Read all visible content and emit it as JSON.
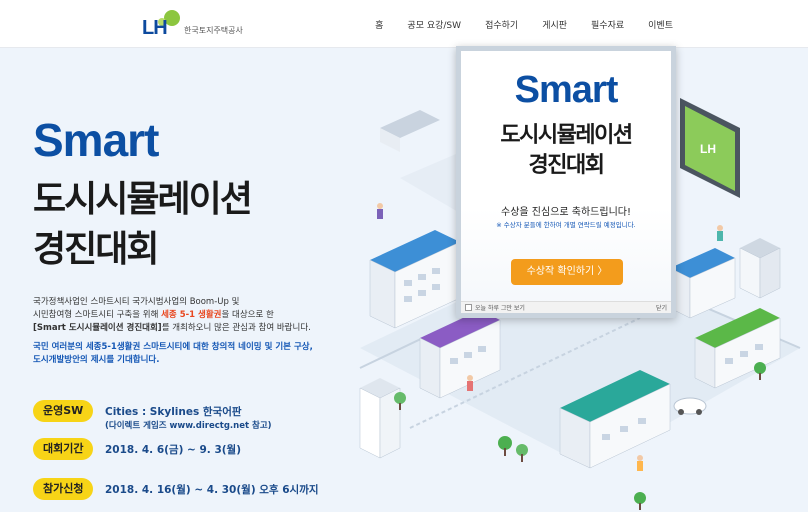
{
  "logo": {
    "mark": "LH",
    "org": "한국토지주택공사"
  },
  "nav": {
    "items": [
      "홈",
      "공모 요강/SW",
      "접수하기",
      "게시판",
      "필수자료",
      "이벤트"
    ]
  },
  "hero": {
    "title_en": "Smart",
    "title_ko_1": "도시시뮬레이션",
    "title_ko_2": "경진대회",
    "desc_line1": "국가정책사업인 스마트시티 국가시범사업의 Boom-Up 및",
    "desc_line2_a": "시민참여형 스마트시티 구축을 위해 ",
    "desc_line2_hl": "세종 5-1 생활권",
    "desc_line2_b": "을 대상으로 한",
    "desc_line3_b": "[Smart 도시시뮬레이션 경진대회]",
    "desc_line3_rest": "를 개최하오니 많은 관심과 참여 바랍니다.",
    "desc2_line1": "국민 여러분의 세종5-1생활권 스마트시티에 대한 창의적 네이밍 및 기본 구상,",
    "desc2_line2": "도시개발방안의 제시를 기대합니다."
  },
  "info": [
    {
      "badge": "운영SW",
      "text": "Cities : Skylines 한국어판"
    },
    {
      "badge": "대회기간",
      "text": "2018. 4. 6(금) ~ 9. 3(월)"
    },
    {
      "badge": "참가신청",
      "text": "2018. 4. 16(월) ~ 4. 30(월) 오후 6시까지"
    }
  ],
  "info_sub": "(다이렉트 게임즈 www.directg.net 참고)",
  "popup": {
    "title_en": "Smart",
    "title_ko_1": "도시시뮬레이션",
    "title_ko_2": "경진대회",
    "message": "수상을 진심으로 축하드립니다!",
    "note": "※ 수상자 분들에 한하여 개별 연락드릴 예정입니다.",
    "button": "수상작 확인하기  〉",
    "today_close": "오늘 하루 그만 보기",
    "close": "닫기"
  },
  "colors": {
    "brand_blue": "#0c4fa3",
    "badge_yellow": "#f7d417",
    "highlight_red": "#e8461e",
    "button_orange": "#f39c1c"
  }
}
